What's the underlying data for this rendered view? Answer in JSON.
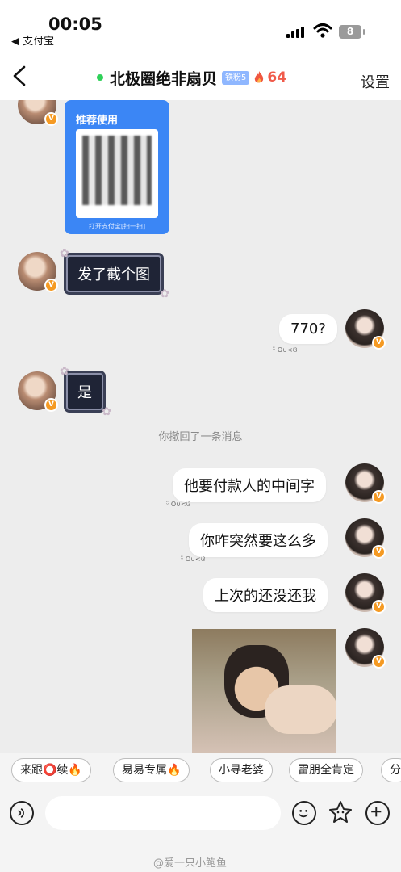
{
  "status_bar": {
    "time": "00:05",
    "back_app": "◀ 支付宝",
    "battery": "8"
  },
  "header": {
    "title": "北极圈绝非扇贝",
    "fan_badge": "铁粉5",
    "fire_count": "64",
    "settings": "设置",
    "online_color": "#2fd159"
  },
  "chat": {
    "qr_card": {
      "title": "推荐使用",
      "footer": "打开支付宝[扫一扫]"
    },
    "messages": [
      {
        "side": "left",
        "text": "发了截个图"
      },
      {
        "side": "right",
        "text": "770?",
        "sticker": "ᵕ̈ O∪<ଓ"
      },
      {
        "side": "left",
        "text": "是"
      },
      {
        "system": "你撤回了一条消息"
      },
      {
        "side": "right",
        "text": "他要付款人的中间字",
        "sticker": "ᵕ̈ O∪<ଓ"
      },
      {
        "side": "right",
        "text": "你咋突然要这么多",
        "sticker": "ᵕ̈ O∪<ଓ"
      },
      {
        "side": "right",
        "text": "上次的还没还我"
      }
    ]
  },
  "quick_replies": [
    "来跟⭕续🔥",
    "易易专属🔥",
    "小寻老婆",
    "雷朋全肯定",
    "分"
  ],
  "watermark": "@爱一只小鲍鱼",
  "colors": {
    "background": "#ededed",
    "dark_bubble": "#1f2436",
    "vip_badge": "#f59a23",
    "fire": "#f05a4a"
  }
}
